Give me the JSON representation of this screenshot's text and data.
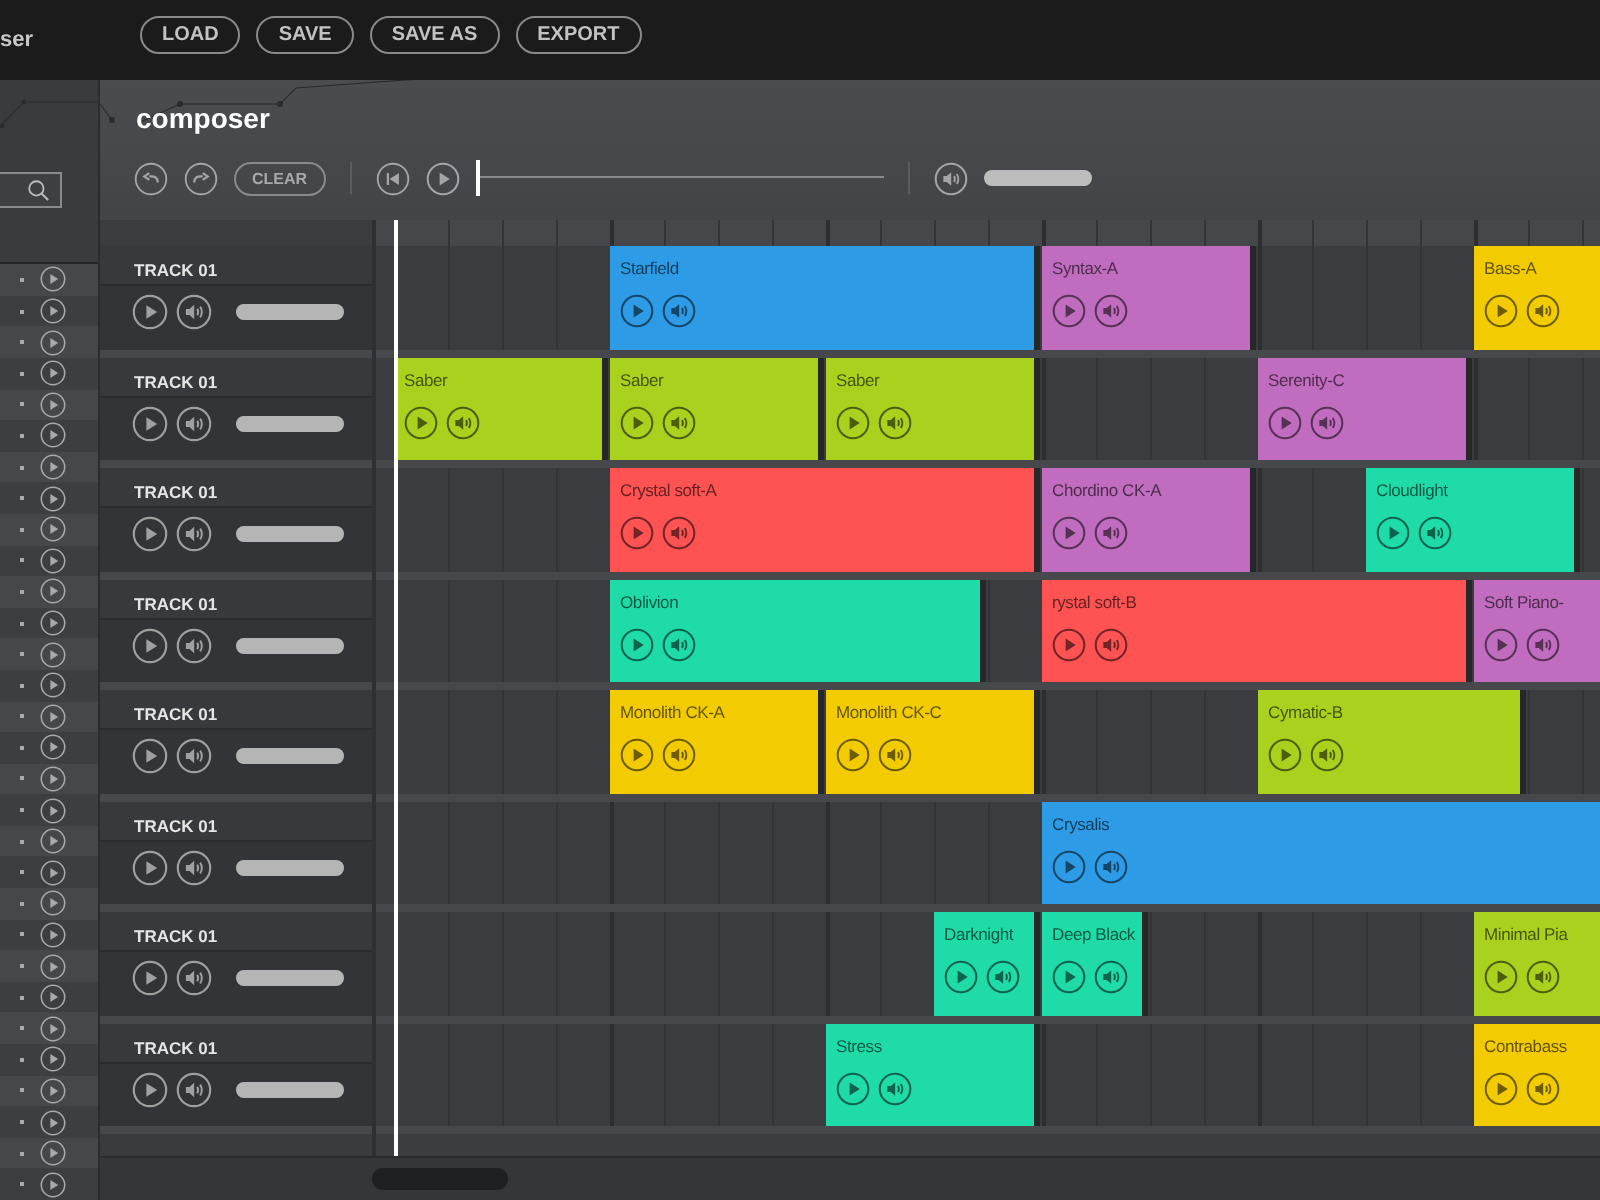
{
  "topbar": {
    "title_fragment": "ser",
    "buttons": [
      "LOAD",
      "SAVE",
      "SAVE AS",
      "EXPORT"
    ]
  },
  "composer": {
    "title": "composer",
    "toolbar": {
      "clear_label": "CLEAR",
      "position": {
        "level": 0
      },
      "volume": {
        "level": 1
      }
    }
  },
  "tracks": [
    {
      "name": "TRACK 01",
      "level": 1,
      "clips": [
        {
          "name": "Starfield",
          "color": "#2d9be6"
        },
        {
          "name": "Syntax-A",
          "color": "#c06cbf"
        },
        {
          "name": "Bass-A",
          "color": "#f2cc00"
        }
      ]
    },
    {
      "name": "TRACK 01",
      "level": 1,
      "clips": [
        {
          "name": "Saber",
          "color": "#a9d11e"
        },
        {
          "name": "Saber",
          "color": "#a9d11e"
        },
        {
          "name": "Saber",
          "color": "#a9d11e"
        },
        {
          "name": "Serenity-C",
          "color": "#c06cbf"
        }
      ]
    },
    {
      "name": "TRACK 01",
      "level": 1,
      "clips": [
        {
          "name": "Crystal soft-A",
          "color": "#ff5252"
        },
        {
          "name": "Chordino CK-A",
          "color": "#c06cbf"
        },
        {
          "name": "Cloudlight",
          "color": "#1fdba8"
        }
      ]
    },
    {
      "name": "TRACK 01",
      "level": 1,
      "clips": [
        {
          "name": "Oblivion",
          "color": "#1fdba8"
        },
        {
          "name": "rystal soft-B",
          "color": "#ff5252"
        },
        {
          "name": "Soft Piano-",
          "color": "#c06cbf"
        }
      ]
    },
    {
      "name": "TRACK 01",
      "level": 1,
      "clips": [
        {
          "name": "Monolith CK-A",
          "color": "#f2cc00"
        },
        {
          "name": "Monolith CK-C",
          "color": "#f2cc00"
        },
        {
          "name": "Cymatic-B",
          "color": "#a9d11e"
        }
      ]
    },
    {
      "name": "TRACK 01",
      "level": 1,
      "clips": [
        {
          "name": "Crysalis",
          "color": "#2d9be6"
        }
      ]
    },
    {
      "name": "TRACK 01",
      "level": 1,
      "clips": [
        {
          "name": "Darknight",
          "color": "#1fdba8"
        },
        {
          "name": "Deep Black",
          "color": "#1fdba8"
        },
        {
          "name": "Minimal Pia",
          "color": "#a9d11e"
        }
      ]
    },
    {
      "name": "TRACK 01",
      "level": 1,
      "clips": [
        {
          "name": "Stress",
          "color": "#1fdba8"
        },
        {
          "name": "Contrabass",
          "color": "#f2cc00"
        }
      ]
    }
  ]
}
